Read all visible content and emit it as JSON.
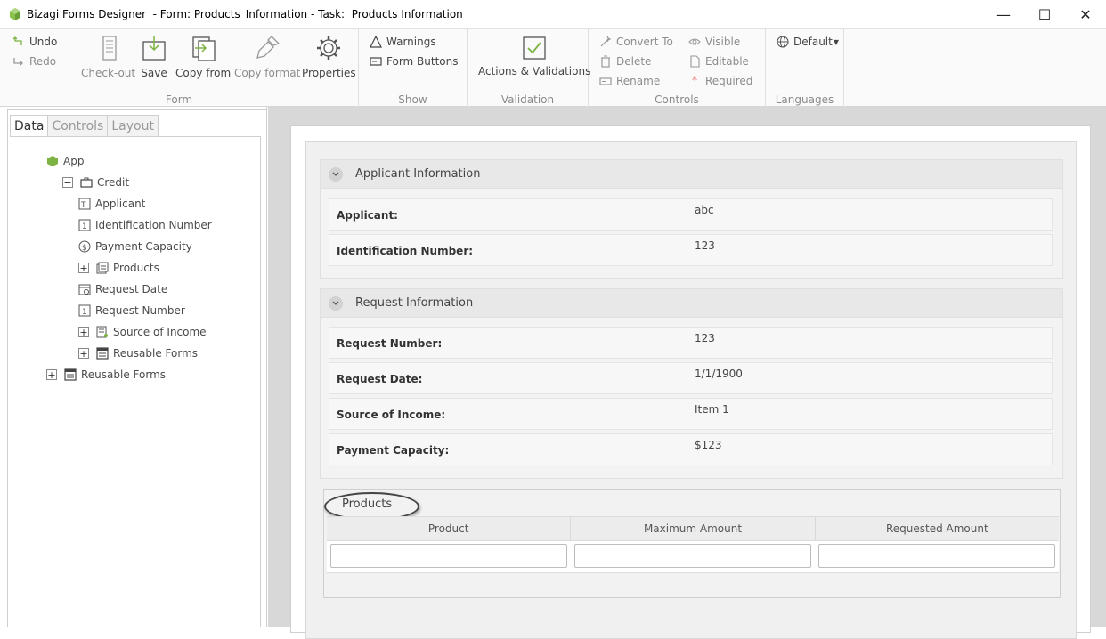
{
  "window": {
    "title": "Bizagi Forms Designer  - Form: Products_Information - Task:  Products Information",
    "minimize": "—",
    "maximize": "☐",
    "close": "✕"
  },
  "ribbon": {
    "undo": "Undo",
    "redo": "Redo",
    "checkout": "Check-out",
    "save": "Save",
    "copy_from": "Copy from",
    "copy_format": "Copy format",
    "properties": "Properties",
    "form_group": "Form",
    "warnings": "Warnings",
    "form_buttons": "Form Buttons",
    "show_group": "Show",
    "actions_validations": "Actions & Validations",
    "validation_group": "Validation",
    "convert_to": "Convert To",
    "delete": "Delete",
    "rename": "Rename",
    "visible": "Visible",
    "editable": "Editable",
    "required": "Required",
    "controls_group": "Controls",
    "language_default": "Default",
    "languages_group": "Languages"
  },
  "left_panel": {
    "tabs": [
      "Data",
      "Controls",
      "Layout"
    ],
    "tree": {
      "app": "App",
      "credit": "Credit",
      "applicant": "Applicant",
      "identification_number": "Identification Number",
      "payment_capacity": "Payment Capacity",
      "products": "Products",
      "request_date": "Request Date",
      "request_number": "Request Number",
      "source_of_income": "Source of Income",
      "reusable_forms_inner": "Reusable Forms",
      "reusable_forms": "Reusable Forms"
    }
  },
  "form": {
    "applicant_group": {
      "title": "Applicant Information",
      "fields": [
        {
          "label": "Applicant:",
          "value": "abc"
        },
        {
          "label": "Identification Number:",
          "value": "123"
        }
      ]
    },
    "request_group": {
      "title": "Request Information",
      "fields": [
        {
          "label": "Request Number:",
          "value": "123"
        },
        {
          "label": "Request Date:",
          "value": "1/1/1900"
        },
        {
          "label": "Source of Income:",
          "value": "Item 1"
        },
        {
          "label": "Payment Capacity:",
          "value": "$123"
        }
      ]
    },
    "products_grid": {
      "title": "Products",
      "columns": [
        "Product",
        "Maximum Amount",
        "Requested Amount"
      ]
    }
  },
  "colors": {
    "bizagi_green": "#7cb342",
    "canvas_bg": "#d8d8d8",
    "annotation_ring": "#444444"
  }
}
